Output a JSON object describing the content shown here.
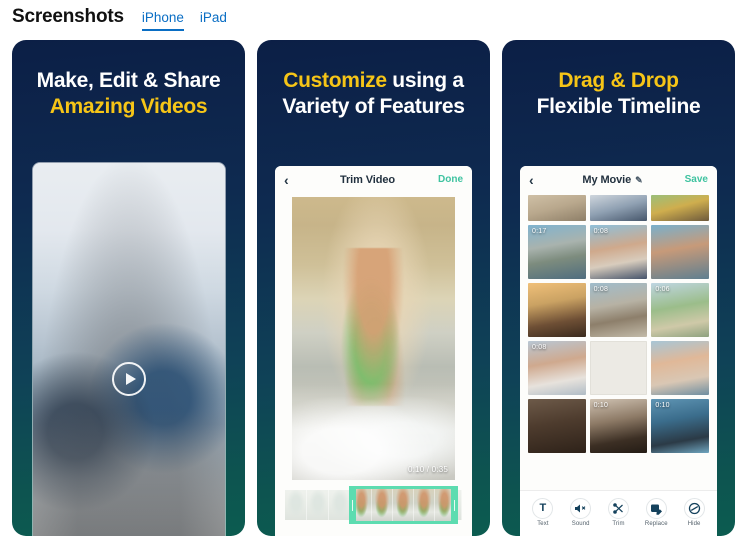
{
  "header": {
    "title": "Screenshots",
    "tabs": [
      {
        "label": "iPhone",
        "active": true
      },
      {
        "label": "iPad",
        "active": false
      }
    ]
  },
  "colors": {
    "accent_blue": "#0a6ec4",
    "headline_yellow": "#f6c517",
    "headline_white": "#ffffff",
    "card_top": "#0c1f46",
    "card_bottom": "#0c5c50",
    "action_green": "#3fc3a0",
    "trim_handle_green": "#5ddcb0"
  },
  "screenshots": [
    {
      "id": "shot-make-edit-share",
      "headline": [
        {
          "text": "Make, Edit & Share",
          "color": "white"
        },
        {
          "text": "Amazing Videos",
          "color": "yellow"
        }
      ],
      "play_icon": "play-icon"
    },
    {
      "id": "shot-customize-features",
      "headline_rich": [
        {
          "text": "Customize",
          "color": "yellow"
        },
        {
          "text": " using a",
          "color": "white"
        }
      ],
      "headline_line2": "Variety of Features",
      "nav": {
        "back_icon": "chevron-left-icon",
        "title": "Trim Video",
        "action": "Done"
      },
      "time_indicator": "0:10 / 0:35"
    },
    {
      "id": "shot-drag-drop-timeline",
      "headline": [
        {
          "text": "Drag & Drop",
          "color": "yellow"
        },
        {
          "text": "Flexible Timeline",
          "color": "white"
        }
      ],
      "nav": {
        "back_icon": "chevron-left-icon",
        "title": "My Movie",
        "edit_icon": "pencil-icon",
        "action": "Save"
      },
      "clips": [
        {
          "duration": "",
          "kind": "half"
        },
        {
          "duration": "",
          "kind": "half"
        },
        {
          "duration": "",
          "kind": "half"
        },
        {
          "duration": "0:17",
          "kind": "clip"
        },
        {
          "duration": "0:08",
          "kind": "clip"
        },
        {
          "duration": "",
          "kind": "clip"
        },
        {
          "duration": "",
          "kind": "clip"
        },
        {
          "duration": "0:08",
          "kind": "clip"
        },
        {
          "duration": "0:06",
          "kind": "clip"
        },
        {
          "duration": "0:08",
          "kind": "clip"
        },
        {
          "duration": "",
          "kind": "empty"
        },
        {
          "duration": "",
          "kind": "clip"
        },
        {
          "duration": "",
          "kind": "clip"
        },
        {
          "duration": "0:10",
          "kind": "clip"
        },
        {
          "duration": "0:10",
          "kind": "clip"
        }
      ],
      "toolbar": [
        {
          "icon": "text-icon",
          "label": "Text"
        },
        {
          "icon": "sound-mute-icon",
          "label": "Sound"
        },
        {
          "icon": "scissors-icon",
          "label": "Trim"
        },
        {
          "icon": "replace-image-icon",
          "label": "Replace"
        },
        {
          "icon": "hide-slash-icon",
          "label": "Hide"
        }
      ]
    }
  ]
}
